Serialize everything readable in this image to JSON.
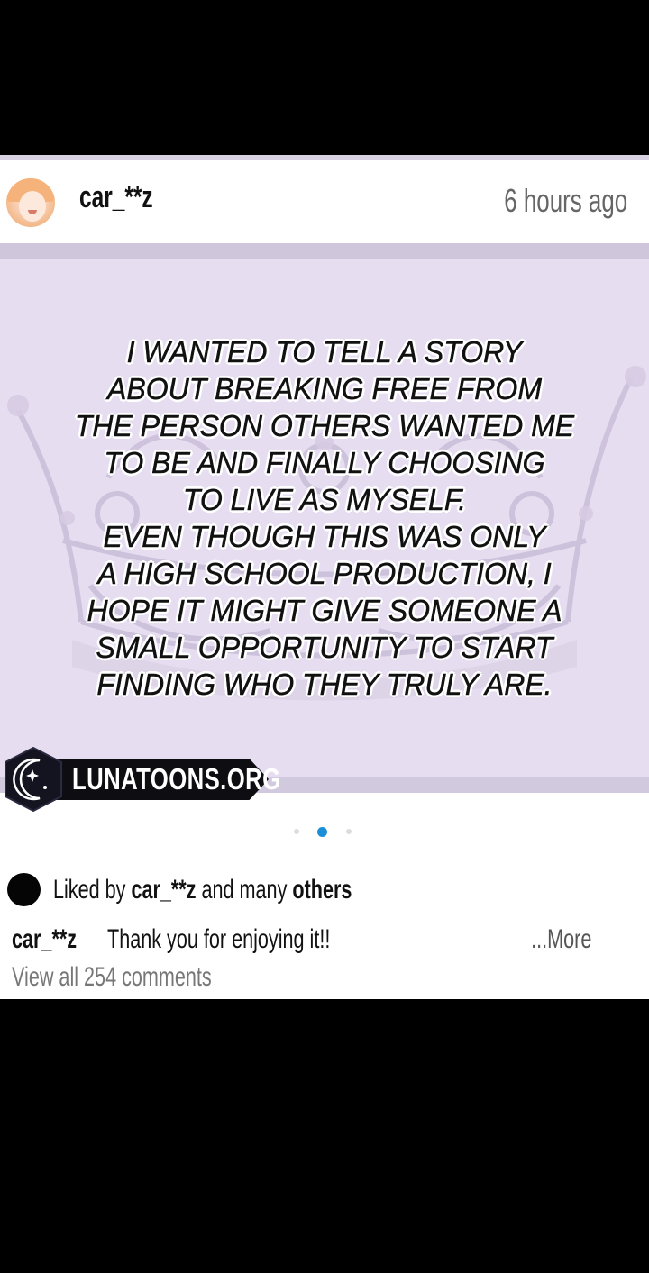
{
  "post": {
    "username": "car_**z",
    "timestamp": "6 hours ago",
    "image_text": "I WANTED TO TELL A STORY\nABOUT BREAKING FREE FROM\nTHE PERSON OTHERS WANTED ME\nTO BE AND FINALLY CHOOSING\nTO LIVE AS MYSELF.\nEVEN THOUGH THIS WAS ONLY\nA HIGH SCHOOL PRODUCTION, I\nHOPE IT MIGHT GIVE SOMEONE A\nSMALL OPPORTUNITY TO START\nFINDING WHO THEY TRULY ARE.",
    "watermark": "LUNATOONS.ORG",
    "carousel": {
      "count": 3,
      "active_index": 1
    },
    "likes": {
      "prefix": "Liked by ",
      "user": "car_**z",
      "middle": " and many ",
      "suffix": "others"
    },
    "caption": {
      "user": "car_**z",
      "text": "Thank you for enjoying it!!",
      "more_label": "...More"
    },
    "view_comments_label": "View all 254 comments"
  },
  "colors": {
    "image_background": "#e6def0",
    "active_dot": "#1b8fd6",
    "watermark_bar": "#0d0d12"
  },
  "icons": {
    "avatar": "user-avatar",
    "likes_avatar": "liker-avatar",
    "watermark_badge": "moon-logo-icon"
  }
}
